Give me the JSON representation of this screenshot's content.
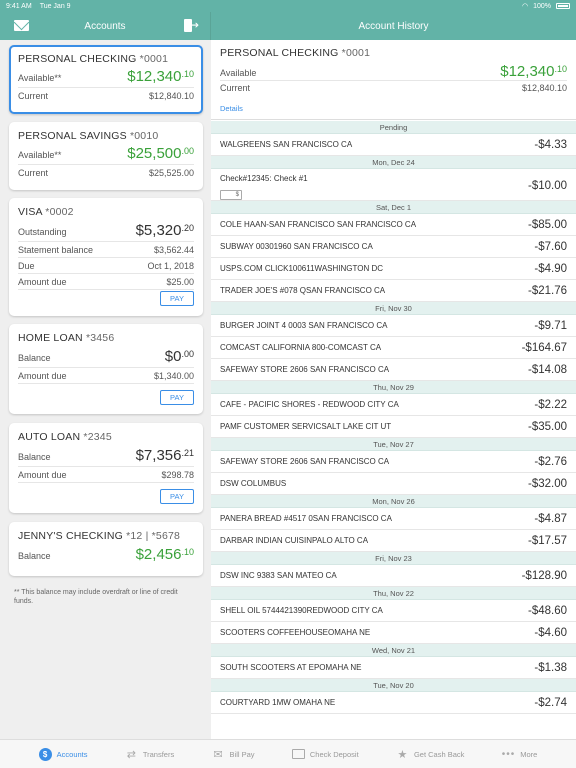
{
  "status": {
    "time": "9:41 AM",
    "date": "Tue Jan 9",
    "battery": "100%"
  },
  "nav": {
    "left_title": "Accounts",
    "right_title": "Account History"
  },
  "accounts": [
    {
      "name": "PERSONAL CHECKING",
      "num": "*0001",
      "rows": [
        {
          "label": "Available**",
          "whole": "$12,340",
          "cents": ".10",
          "green": true
        },
        {
          "label": "Current",
          "value": "$12,840.10"
        }
      ]
    },
    {
      "name": "PERSONAL SAVINGS",
      "num": "*0010",
      "rows": [
        {
          "label": "Available**",
          "whole": "$25,500",
          "cents": ".00",
          "green": true
        },
        {
          "label": "Current",
          "value": "$25,525.00"
        }
      ]
    },
    {
      "name": "VISA",
      "num": "*0002",
      "rows": [
        {
          "label": "Outstanding",
          "whole": "$5,320",
          "cents": ".20",
          "green": false
        },
        {
          "label": "Statement balance",
          "value": "$3,562.44"
        },
        {
          "label": "Due",
          "value": "Oct 1, 2018"
        },
        {
          "label": "Amount due",
          "value": "$25.00"
        }
      ],
      "pay": "PAY"
    },
    {
      "name": "HOME LOAN",
      "num": "*3456",
      "rows": [
        {
          "label": "Balance",
          "whole": "$0",
          "cents": ".00",
          "green": false
        },
        {
          "label": "Amount due",
          "value": "$1,340.00"
        }
      ],
      "pay": "PAY"
    },
    {
      "name": "AUTO LOAN",
      "num": "*2345",
      "rows": [
        {
          "label": "Balance",
          "whole": "$7,356",
          "cents": ".21",
          "green": false
        },
        {
          "label": "Amount due",
          "value": "$298.78"
        }
      ],
      "pay": "PAY"
    },
    {
      "name": "JENNY'S CHECKING",
      "num": "*12 | *5678",
      "rows": [
        {
          "label": "Balance",
          "whole": "$2,456",
          "cents": ".10",
          "green": true
        }
      ]
    }
  ],
  "footnote": "** This balance may include overdraft or line of credit funds.",
  "summary": {
    "name": "PERSONAL CHECKING",
    "num": "*0001",
    "available_label": "Available",
    "available_whole": "$12,340",
    "available_cents": ".10",
    "current_label": "Current",
    "current_value": "$12,840.10",
    "details": "Details"
  },
  "transactions": [
    {
      "header": "Pending",
      "items": [
        {
          "desc": "WALGREENS SAN FRANCISCO CA",
          "amt": "-$4.33"
        }
      ]
    },
    {
      "header": "Mon, Dec 24",
      "items": [
        {
          "desc": "Check#12345: Check #1",
          "amt": "-$10.00",
          "check": true
        }
      ]
    },
    {
      "header": "Sat, Dec 1",
      "items": [
        {
          "desc": "COLE HAAN-SAN FRANCISCO SAN FRANCISCO CA",
          "amt": "-$85.00"
        },
        {
          "desc": "SUBWAY 00301960 SAN FRANCISCO CA",
          "amt": "-$7.60"
        },
        {
          "desc": "USPS.COM CLICK100611WASHINGTON DC",
          "amt": "-$4.90"
        },
        {
          "desc": "TRADER JOE'S #078 QSAN FRANCISCO CA",
          "amt": "-$21.76"
        }
      ]
    },
    {
      "header": "Fri, Nov 30",
      "items": [
        {
          "desc": "BURGER JOINT 4 0003 SAN FRANCISCO CA",
          "amt": "-$9.71"
        },
        {
          "desc": "COMCAST CALIFORNIA 800-COMCAST CA",
          "amt": "-$164.67"
        },
        {
          "desc": "SAFEWAY STORE 2606 SAN FRANCISCO CA",
          "amt": "-$14.08"
        }
      ]
    },
    {
      "header": "Thu, Nov 29",
      "items": [
        {
          "desc": "CAFE - PACIFIC SHORES - REDWOOD CITY CA",
          "amt": "-$2.22"
        },
        {
          "desc": "PAMF CUSTOMER SERVICSALT LAKE CIT UT",
          "amt": "-$35.00"
        }
      ]
    },
    {
      "header": "Tue, Nov 27",
      "items": [
        {
          "desc": "SAFEWAY STORE 2606 SAN FRANCISCO CA",
          "amt": "-$2.76"
        },
        {
          "desc": "DSW COLUMBUS",
          "amt": "-$32.00"
        }
      ]
    },
    {
      "header": "Mon, Nov 26",
      "items": [
        {
          "desc": "PANERA BREAD #4517 0SAN FRANCISCO CA",
          "amt": "-$4.87"
        },
        {
          "desc": "DARBAR INDIAN CUISINPALO ALTO CA",
          "amt": "-$17.57"
        }
      ]
    },
    {
      "header": "Fri, Nov 23",
      "items": [
        {
          "desc": "DSW INC 9383 SAN MATEO CA",
          "amt": "-$128.90"
        }
      ]
    },
    {
      "header": "Thu, Nov 22",
      "items": [
        {
          "desc": "SHELL OIL 5744421390REDWOOD CITY CA",
          "amt": "-$48.60"
        },
        {
          "desc": "SCOOTERS COFFEEHOUSEOMAHA NE",
          "amt": "-$4.60"
        }
      ]
    },
    {
      "header": "Wed, Nov 21",
      "items": [
        {
          "desc": "SOUTH SCOOTERS AT EPOMAHA NE",
          "amt": "-$1.38"
        }
      ]
    },
    {
      "header": "Tue, Nov 20",
      "items": [
        {
          "desc": "COURTYARD 1MW OMAHA NE",
          "amt": "-$2.74"
        }
      ]
    }
  ],
  "tabs": [
    {
      "label": "Accounts",
      "icon": "dollar-icon",
      "active": true
    },
    {
      "label": "Transfers",
      "icon": "transfer-icon",
      "active": false
    },
    {
      "label": "Bill Pay",
      "icon": "bill-pay-icon",
      "active": false
    },
    {
      "label": "Check Deposit",
      "icon": "check-deposit-icon",
      "active": false
    },
    {
      "label": "Get Cash Back",
      "icon": "star-icon",
      "active": false
    },
    {
      "label": "More",
      "icon": "more-dots-icon",
      "active": false
    }
  ],
  "colors": {
    "header": "#62b3a7",
    "accent": "#3a8ee6",
    "positive": "#3aa13a",
    "section": "#e3f1ef"
  }
}
